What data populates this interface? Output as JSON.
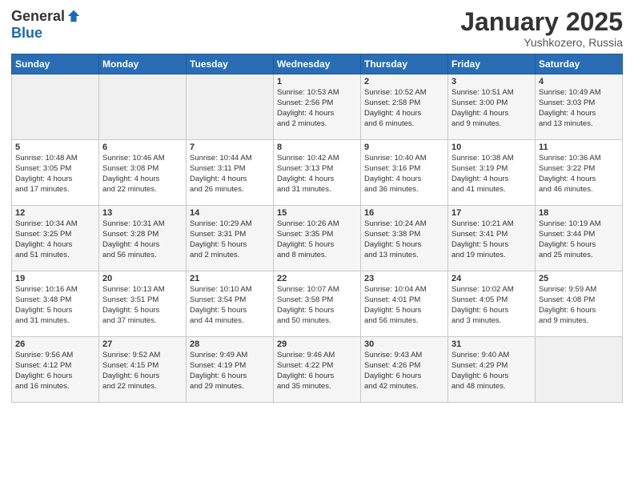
{
  "header": {
    "logo_general": "General",
    "logo_blue": "Blue",
    "month": "January 2025",
    "location": "Yushkozero, Russia"
  },
  "days_of_week": [
    "Sunday",
    "Monday",
    "Tuesday",
    "Wednesday",
    "Thursday",
    "Friday",
    "Saturday"
  ],
  "weeks": [
    [
      {
        "day": "",
        "info": ""
      },
      {
        "day": "",
        "info": ""
      },
      {
        "day": "",
        "info": ""
      },
      {
        "day": "1",
        "info": "Sunrise: 10:53 AM\nSunset: 2:56 PM\nDaylight: 4 hours\nand 2 minutes."
      },
      {
        "day": "2",
        "info": "Sunrise: 10:52 AM\nSunset: 2:58 PM\nDaylight: 4 hours\nand 6 minutes."
      },
      {
        "day": "3",
        "info": "Sunrise: 10:51 AM\nSunset: 3:00 PM\nDaylight: 4 hours\nand 9 minutes."
      },
      {
        "day": "4",
        "info": "Sunrise: 10:49 AM\nSunset: 3:03 PM\nDaylight: 4 hours\nand 13 minutes."
      }
    ],
    [
      {
        "day": "5",
        "info": "Sunrise: 10:48 AM\nSunset: 3:05 PM\nDaylight: 4 hours\nand 17 minutes."
      },
      {
        "day": "6",
        "info": "Sunrise: 10:46 AM\nSunset: 3:08 PM\nDaylight: 4 hours\nand 22 minutes."
      },
      {
        "day": "7",
        "info": "Sunrise: 10:44 AM\nSunset: 3:11 PM\nDaylight: 4 hours\nand 26 minutes."
      },
      {
        "day": "8",
        "info": "Sunrise: 10:42 AM\nSunset: 3:13 PM\nDaylight: 4 hours\nand 31 minutes."
      },
      {
        "day": "9",
        "info": "Sunrise: 10:40 AM\nSunset: 3:16 PM\nDaylight: 4 hours\nand 36 minutes."
      },
      {
        "day": "10",
        "info": "Sunrise: 10:38 AM\nSunset: 3:19 PM\nDaylight: 4 hours\nand 41 minutes."
      },
      {
        "day": "11",
        "info": "Sunrise: 10:36 AM\nSunset: 3:22 PM\nDaylight: 4 hours\nand 46 minutes."
      }
    ],
    [
      {
        "day": "12",
        "info": "Sunrise: 10:34 AM\nSunset: 3:25 PM\nDaylight: 4 hours\nand 51 minutes."
      },
      {
        "day": "13",
        "info": "Sunrise: 10:31 AM\nSunset: 3:28 PM\nDaylight: 4 hours\nand 56 minutes."
      },
      {
        "day": "14",
        "info": "Sunrise: 10:29 AM\nSunset: 3:31 PM\nDaylight: 5 hours\nand 2 minutes."
      },
      {
        "day": "15",
        "info": "Sunrise: 10:26 AM\nSunset: 3:35 PM\nDaylight: 5 hours\nand 8 minutes."
      },
      {
        "day": "16",
        "info": "Sunrise: 10:24 AM\nSunset: 3:38 PM\nDaylight: 5 hours\nand 13 minutes."
      },
      {
        "day": "17",
        "info": "Sunrise: 10:21 AM\nSunset: 3:41 PM\nDaylight: 5 hours\nand 19 minutes."
      },
      {
        "day": "18",
        "info": "Sunrise: 10:19 AM\nSunset: 3:44 PM\nDaylight: 5 hours\nand 25 minutes."
      }
    ],
    [
      {
        "day": "19",
        "info": "Sunrise: 10:16 AM\nSunset: 3:48 PM\nDaylight: 5 hours\nand 31 minutes."
      },
      {
        "day": "20",
        "info": "Sunrise: 10:13 AM\nSunset: 3:51 PM\nDaylight: 5 hours\nand 37 minutes."
      },
      {
        "day": "21",
        "info": "Sunrise: 10:10 AM\nSunset: 3:54 PM\nDaylight: 5 hours\nand 44 minutes."
      },
      {
        "day": "22",
        "info": "Sunrise: 10:07 AM\nSunset: 3:58 PM\nDaylight: 5 hours\nand 50 minutes."
      },
      {
        "day": "23",
        "info": "Sunrise: 10:04 AM\nSunset: 4:01 PM\nDaylight: 5 hours\nand 56 minutes."
      },
      {
        "day": "24",
        "info": "Sunrise: 10:02 AM\nSunset: 4:05 PM\nDaylight: 6 hours\nand 3 minutes."
      },
      {
        "day": "25",
        "info": "Sunrise: 9:59 AM\nSunset: 4:08 PM\nDaylight: 6 hours\nand 9 minutes."
      }
    ],
    [
      {
        "day": "26",
        "info": "Sunrise: 9:56 AM\nSunset: 4:12 PM\nDaylight: 6 hours\nand 16 minutes."
      },
      {
        "day": "27",
        "info": "Sunrise: 9:52 AM\nSunset: 4:15 PM\nDaylight: 6 hours\nand 22 minutes."
      },
      {
        "day": "28",
        "info": "Sunrise: 9:49 AM\nSunset: 4:19 PM\nDaylight: 6 hours\nand 29 minutes."
      },
      {
        "day": "29",
        "info": "Sunrise: 9:46 AM\nSunset: 4:22 PM\nDaylight: 6 hours\nand 35 minutes."
      },
      {
        "day": "30",
        "info": "Sunrise: 9:43 AM\nSunset: 4:26 PM\nDaylight: 6 hours\nand 42 minutes."
      },
      {
        "day": "31",
        "info": "Sunrise: 9:40 AM\nSunset: 4:29 PM\nDaylight: 6 hours\nand 48 minutes."
      },
      {
        "day": "",
        "info": ""
      }
    ]
  ]
}
